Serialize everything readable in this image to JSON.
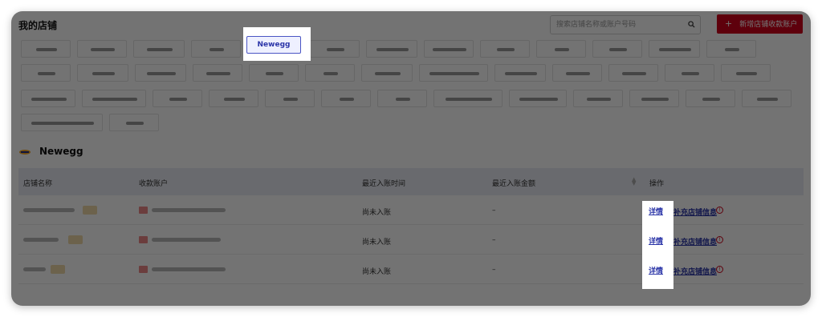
{
  "header": {
    "title": "我的店铺"
  },
  "search": {
    "placeholder": "搜索店铺名称或账户号码",
    "icon": "search-icon"
  },
  "add_button": {
    "label": "新增店铺收款账户",
    "icon": "plus-icon",
    "color": "#d0021b"
  },
  "platform_chips": {
    "active_label": "Newegg"
  },
  "section": {
    "title": "Newegg",
    "logo_icon": "newegg-logo-icon"
  },
  "table": {
    "columns": [
      "店铺名称",
      "收款账户",
      "最近入账时间",
      "最近入账金额",
      "操作"
    ],
    "rows": [
      {
        "last_time": "尚未入账",
        "last_amount": "–",
        "detail": "详情",
        "supplement": "补充店铺信息"
      },
      {
        "last_time": "尚未入账",
        "last_amount": "–",
        "detail": "详情",
        "supplement": "补充店铺信息"
      },
      {
        "last_time": "尚未入账",
        "last_amount": "–",
        "detail": "详情",
        "supplement": "补充店铺信息"
      }
    ]
  },
  "colors": {
    "accent": "#d0021b",
    "link": "#2b35a8",
    "header_bg": "#e9ecf3"
  }
}
